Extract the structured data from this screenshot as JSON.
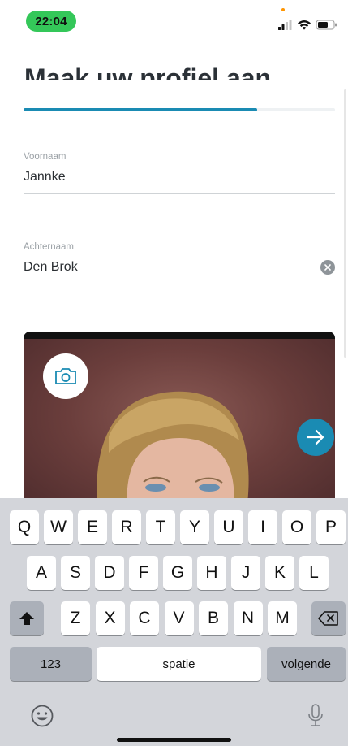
{
  "status_bar": {
    "time": "22:04"
  },
  "header": {
    "title": "Maak uw profiel aan"
  },
  "progress": {
    "fraction": 0.75
  },
  "fields": {
    "first_name": {
      "label": "Voornaam",
      "value": "Jannke"
    },
    "last_name": {
      "label": "Achternaam",
      "value": "Den Brok"
    }
  },
  "icons": {
    "camera": "camera-icon",
    "next": "arrow-right-icon",
    "clear": "clear-x-icon",
    "shift": "shift-icon",
    "backspace": "backspace-icon",
    "emoji": "emoji-icon",
    "mic": "microphone-icon"
  },
  "colors": {
    "accent": "#1a8bb3",
    "time_pill": "#34c759"
  },
  "keyboard": {
    "row1": [
      "Q",
      "W",
      "E",
      "R",
      "T",
      "Y",
      "U",
      "I",
      "O",
      "P"
    ],
    "row2": [
      "A",
      "S",
      "D",
      "F",
      "G",
      "H",
      "J",
      "K",
      "L"
    ],
    "row3": [
      "Z",
      "X",
      "C",
      "V",
      "B",
      "N",
      "M"
    ],
    "numbers_key": "123",
    "space_key": "spatie",
    "return_key": "volgende"
  }
}
